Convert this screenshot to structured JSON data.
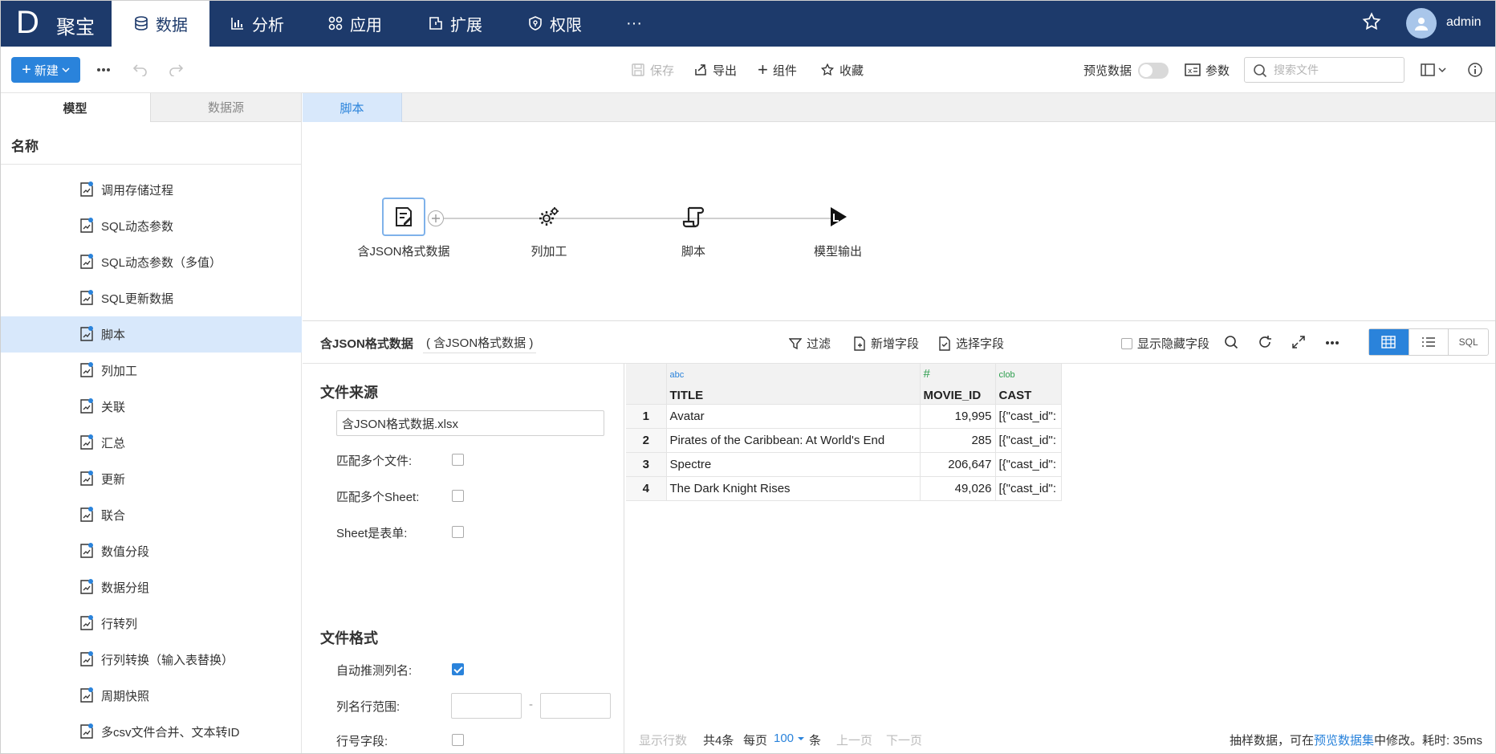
{
  "brand": {
    "mark": "D",
    "name": "聚宝"
  },
  "nav": [
    {
      "label": "数据",
      "icon": "database-icon"
    },
    {
      "label": "分析",
      "icon": "bar-chart-icon"
    },
    {
      "label": "应用",
      "icon": "apps-icon"
    },
    {
      "label": "扩展",
      "icon": "extension-icon"
    },
    {
      "label": "权限",
      "icon": "shield-icon"
    },
    {
      "label": "···",
      "icon": "more-icon"
    }
  ],
  "user": {
    "name": "admin"
  },
  "toolbar": {
    "new_label": "新建",
    "save_label": "保存",
    "export_label": "导出",
    "component_label": "组件",
    "favorite_label": "收藏",
    "preview_label": "预览数据",
    "params_label": "参数",
    "search_placeholder": "搜索文件"
  },
  "left_tabs": [
    "模型",
    "数据源"
  ],
  "left_header": "名称",
  "tree": [
    "调用存储过程",
    "SQL动态参数",
    "SQL动态参数（多值）",
    "SQL更新数据",
    "脚本",
    "列加工",
    "关联",
    "汇总",
    "更新",
    "联合",
    "数值分段",
    "数据分组",
    "行转列",
    "行列转换（输入表替换）",
    "周期快照",
    "多csv文件合并、文本转ID"
  ],
  "selected_tree_item": "脚本",
  "editor_tab": "脚本",
  "flow_nodes": [
    "含JSON格式数据",
    "列加工",
    "脚本",
    "模型输出"
  ],
  "panel": {
    "title": "含JSON格式数据",
    "subtitle": "( 含JSON格式数据 )",
    "filter_label": "过滤",
    "add_field_label": "新增字段",
    "select_field_label": "选择字段",
    "show_hidden_label": "显示隐藏字段",
    "sql_label": "SQL"
  },
  "props": {
    "file_source_title": "文件来源",
    "file_name": "含JSON格式数据.xlsx",
    "match_files_label": "匹配多个文件:",
    "match_sheets_label": "匹配多个Sheet:",
    "sheet_is_form_label": "Sheet是表单:",
    "file_format_title": "文件格式",
    "auto_detect_label": "自动推测列名:",
    "header_range_label": "列名行范围:",
    "range_sep": "-",
    "row_no_label": "行号字段:"
  },
  "table": {
    "columns": [
      {
        "type": "abc",
        "name": "TITLE",
        "type_color": "#2a83db"
      },
      {
        "type": "#",
        "name": "MOVIE_ID",
        "type_color": "#2e9e4f"
      },
      {
        "type": "clob",
        "name": "CAST",
        "type_color": "#2e9e4f"
      }
    ],
    "rows": [
      {
        "n": "1",
        "title": "Avatar",
        "id": "19,995",
        "cast": "[{\"cast_id\":"
      },
      {
        "n": "2",
        "title": "Pirates of the Caribbean: At World's End",
        "id": "285",
        "cast": "[{\"cast_id\":"
      },
      {
        "n": "3",
        "title": "Spectre",
        "id": "206,647",
        "cast": "[{\"cast_id\":"
      },
      {
        "n": "4",
        "title": "The Dark Knight Rises",
        "id": "49,026",
        "cast": "[{\"cast_id\":"
      }
    ]
  },
  "footer": {
    "show_rows": "显示行数",
    "total": "共4条",
    "per_page_prefix": "每页",
    "per_page_value": "100",
    "per_page_suffix": "条",
    "prev": "上一页",
    "next": "下一页",
    "note_prefix": "抽样数据，可在",
    "note_link": "预览数据集",
    "note_suffix": "中修改。耗时: 35ms"
  },
  "colors": {
    "topbar": "#1d3a6b",
    "accent": "#2a83db",
    "selected_bg": "#d8e8fb"
  }
}
